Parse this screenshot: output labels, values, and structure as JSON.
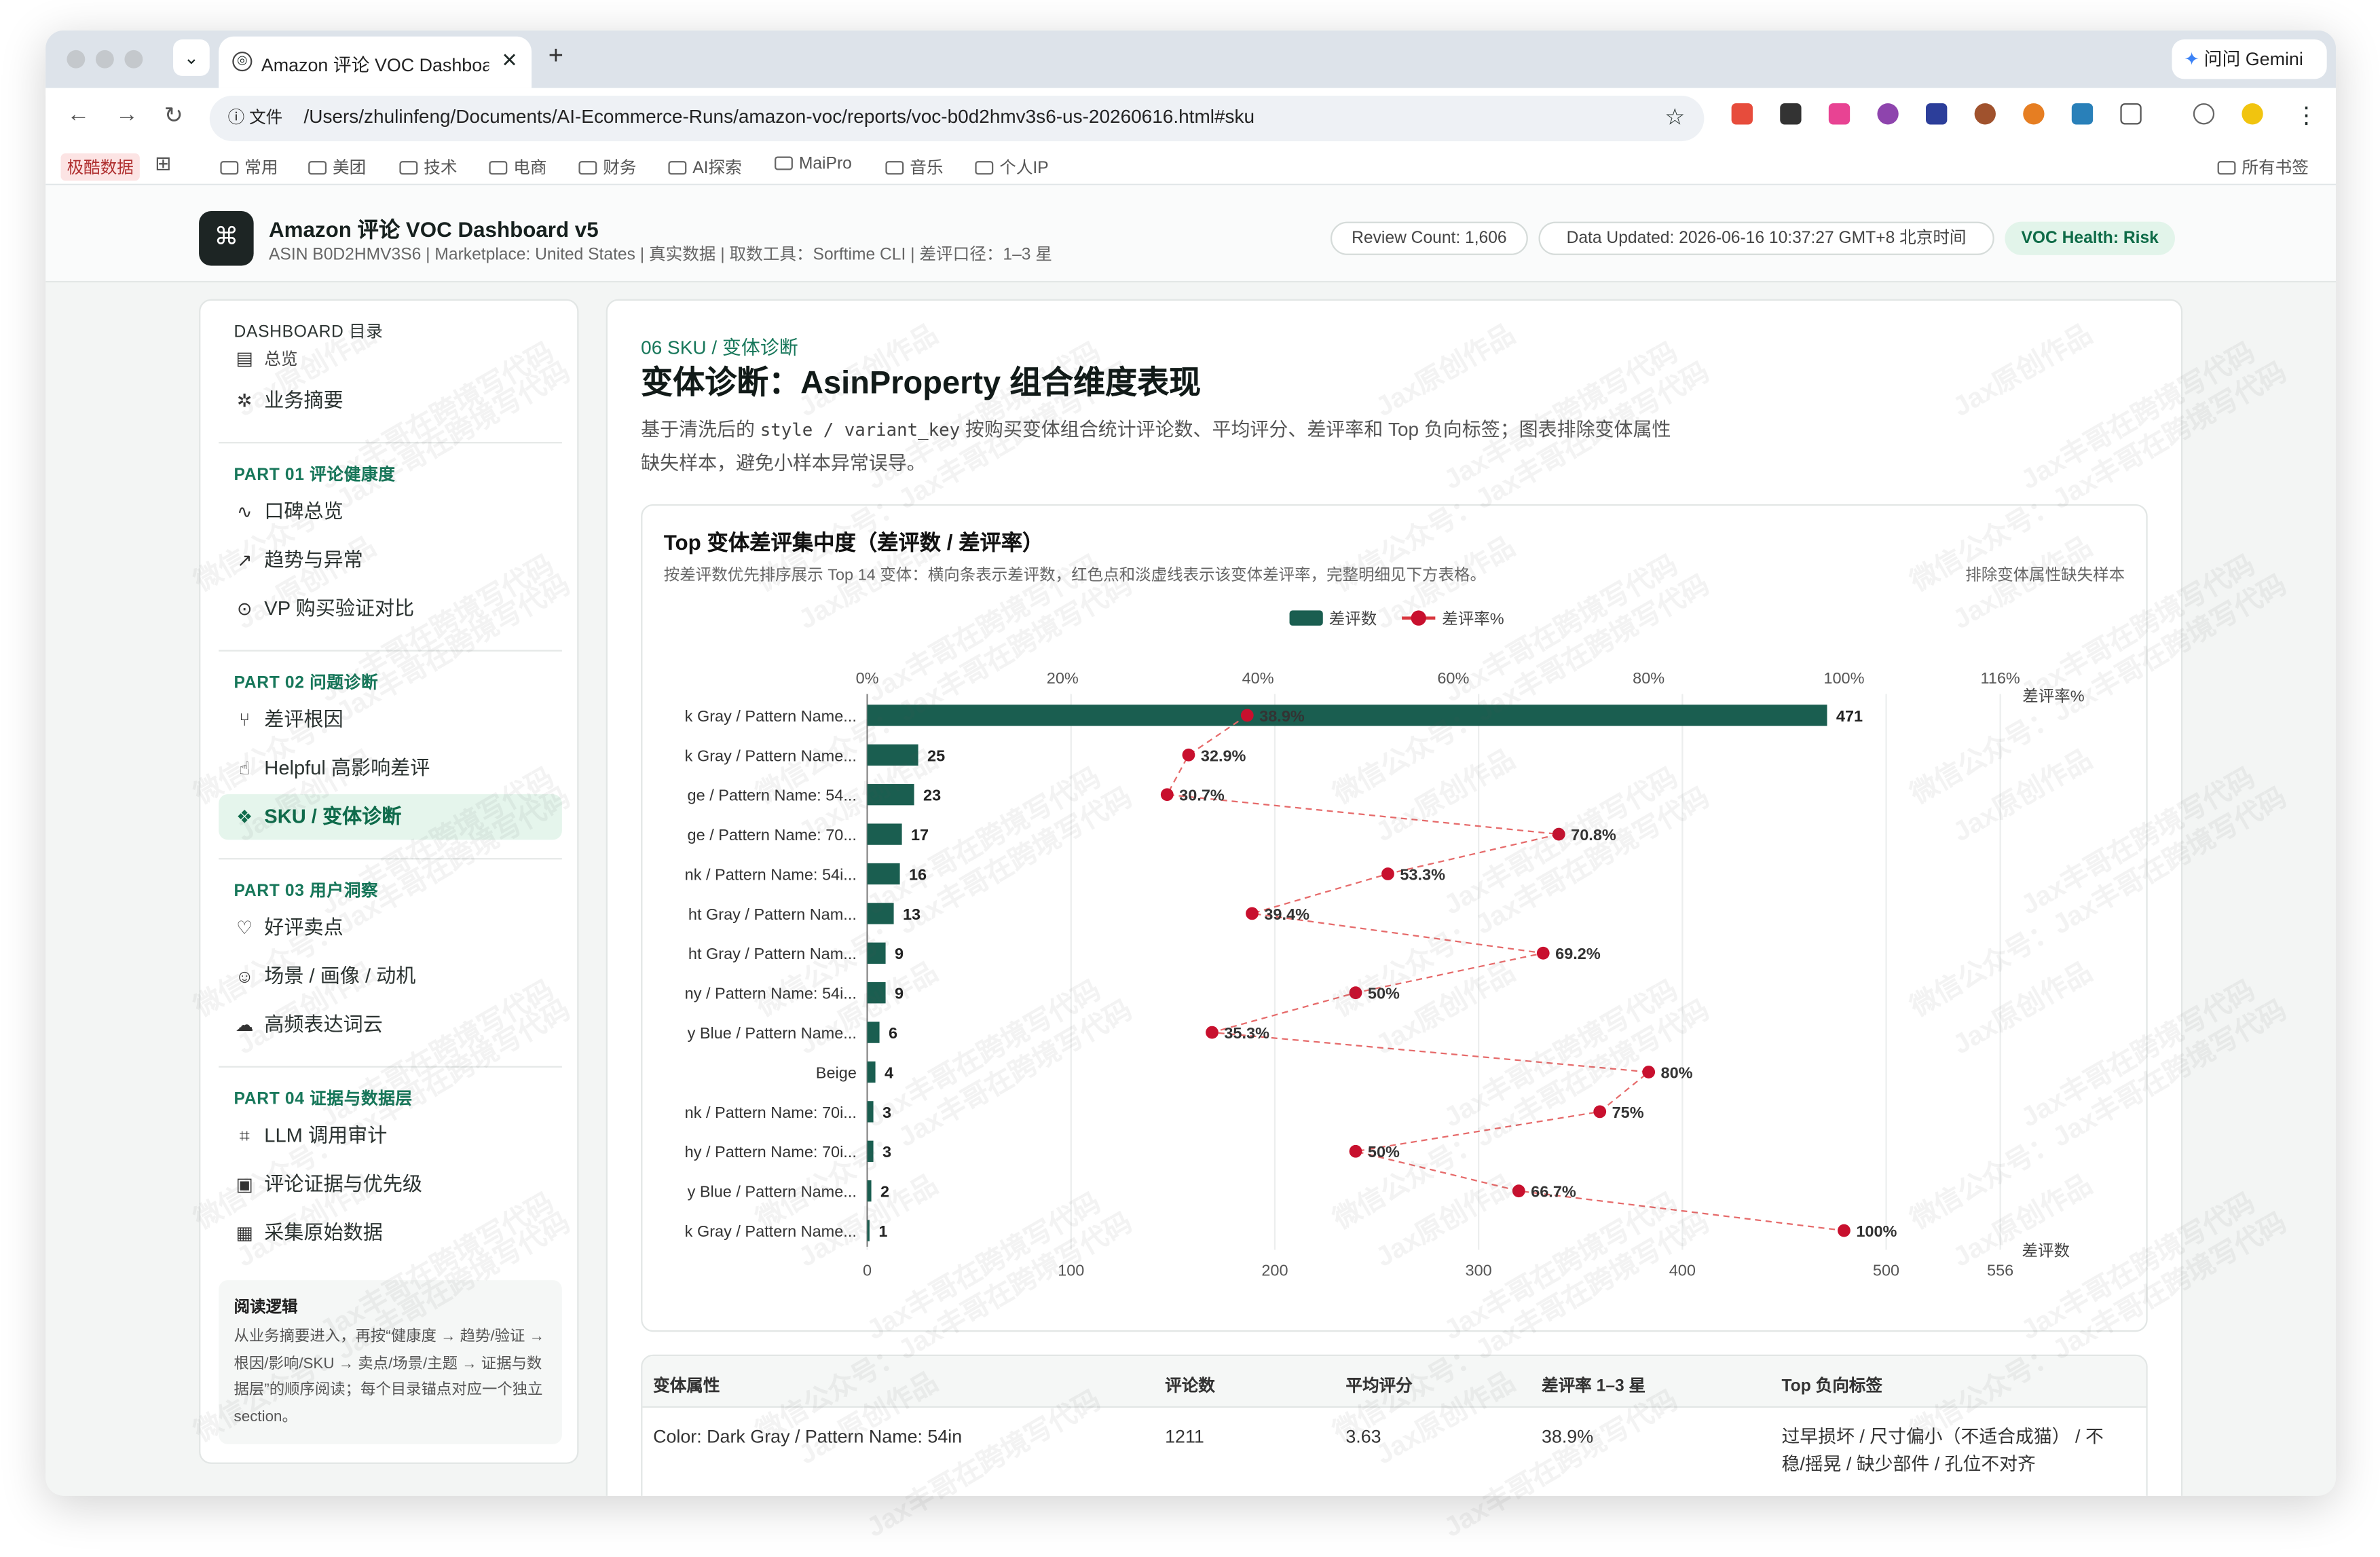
{
  "browser": {
    "tab_title": "Amazon 评论 VOC Dashboard",
    "new_tab": "+",
    "gemini": "问问 Gemini",
    "url_chip": "文件",
    "url": "/Users/zhulinfeng/Documents/AI-Ecommerce-Runs/amazon-voc/reports/voc-b0d2hmv3s6-us-20260616.html#sku",
    "bookmarks": [
      "极酷数据",
      "常用",
      "美团",
      "技术",
      "电商",
      "财务",
      "AI探索",
      "MaiPro",
      "音乐",
      "个人IP"
    ],
    "all_bookmarks": "所有书签"
  },
  "header": {
    "title": "Amazon 评论 VOC Dashboard v5",
    "meta": "ASIN B0D2HMV3S6  |  Marketplace: United States  |  真实数据  |  取数工具：Sorftime CLI  |  差评口径：1–3 星",
    "review_count": "Review Count: 1,606",
    "data_updated": "Data Updated: 2026-06-16 10:37:27 GMT+8 北京时间",
    "health": "VOC Health: Risk"
  },
  "sidebar": {
    "title": "DASHBOARD 目录",
    "overview": "总览",
    "summary": "业务摘要",
    "parts": [
      {
        "label": "PART 01 评论健康度",
        "items": [
          "口碑总览",
          "趋势与异常",
          "VP 购买验证对比"
        ]
      },
      {
        "label": "PART 02 问题诊断",
        "items": [
          "差评根因",
          "Helpful 高影响差评",
          "SKU / 变体诊断"
        ]
      },
      {
        "label": "PART 03 用户洞察",
        "items": [
          "好评卖点",
          "场景 / 画像 / 动机",
          "高频表达词云"
        ]
      },
      {
        "label": "PART 04 证据与数据层",
        "items": [
          "LLM 调用审计",
          "评论证据与优先级",
          "采集原始数据"
        ]
      }
    ],
    "note_title": "阅读逻辑",
    "note_body": "从业务摘要进入，再按“健康度 → 趋势/验证 → 根因/影响/SKU → 卖点/场景/主题 → 证据与数据层”的顺序阅读；每个目录锚点对应一个独立 section。"
  },
  "section": {
    "eyebrow": "06 SKU / 变体诊断",
    "title": "变体诊断：AsinProperty 组合维度表现",
    "desc_pre": "基于清洗后的 ",
    "desc_code": "style / variant_key",
    "desc_post": " 按购买变体组合统计评论数、平均评分、差评率和 Top 负向标签；图表排除变体属性缺失样本，避免小样本异常误导。"
  },
  "chart_card": {
    "title": "Top 变体差评集中度（差评数 / 差评率）",
    "subtitle": "按差评数优先排序展示 Top 14 变体：横向条表示差评数，红色点和淡虚线表示该变体差评率，完整明细见下方表格。",
    "note": "排除变体属性缺失样本",
    "legend_bar": "差评数",
    "legend_line": "差评率%"
  },
  "chart_data": {
    "type": "bar",
    "orientation": "horizontal",
    "categories": [
      "k Gray / Pattern Name...",
      "k Gray / Pattern Name...",
      "ge / Pattern Name: 54...",
      "ge / Pattern Name: 70...",
      "nk / Pattern Name: 54i...",
      "ht Gray / Pattern Nam...",
      "ht Gray / Pattern Nam...",
      "ny / Pattern Name: 54i...",
      "y Blue / Pattern Name...",
      "Beige",
      "nk / Pattern Name: 70i...",
      "hy / Pattern Name: 70i...",
      "y Blue / Pattern Name...",
      "k Gray / Pattern Name..."
    ],
    "series": [
      {
        "name": "差评数",
        "values": [
          471,
          25,
          23,
          17,
          16,
          13,
          9,
          9,
          6,
          4,
          3,
          3,
          2,
          1
        ],
        "color": "#1a5e50"
      },
      {
        "name": "差评率%",
        "values": [
          38.9,
          32.9,
          30.7,
          70.8,
          53.3,
          39.4,
          69.2,
          50,
          35.3,
          80,
          75,
          50,
          66.7,
          100
        ],
        "labels": [
          "38.9%",
          "32.9%",
          "30.7%",
          "70.8%",
          "53.3%",
          "39.4%",
          "69.2%",
          "50%",
          "35.3%",
          "80%",
          "75%",
          "50%",
          "66.7%",
          "100%"
        ],
        "color": "#c8102e"
      }
    ],
    "x_bottom": {
      "label": "差评数",
      "ticks": [
        "0",
        "100",
        "200",
        "300",
        "400",
        "500",
        "556"
      ],
      "range": [
        0,
        556
      ]
    },
    "x_top": {
      "label": "差评率%",
      "ticks": [
        "0%",
        "20%",
        "40%",
        "60%",
        "80%",
        "100%",
        "116%"
      ],
      "range": [
        0,
        116
      ]
    },
    "grid": true
  },
  "table": {
    "headers": [
      "变体属性",
      "评论数",
      "平均评分",
      "差评率 1–3 星",
      "Top 负向标签"
    ],
    "rows": [
      [
        "Color: Dark Gray / Pattern Name: 54in",
        "1211",
        "3.63",
        "38.9%",
        "过早损坏 / 尺寸偏小（不适合成猫） / 不稳/摇晃 / 缺少部件 / 孔位不对齐"
      ]
    ]
  },
  "watermark": [
    "Jax原创作品",
    "Jax丰哥在跨境写代码",
    "微信公众号：Jax丰哥在跨境写代码"
  ],
  "colors": {
    "accent": "#17775a",
    "bar": "#1a5e50",
    "rate": "#c8102e",
    "health_bg": "#e2f4ea"
  }
}
